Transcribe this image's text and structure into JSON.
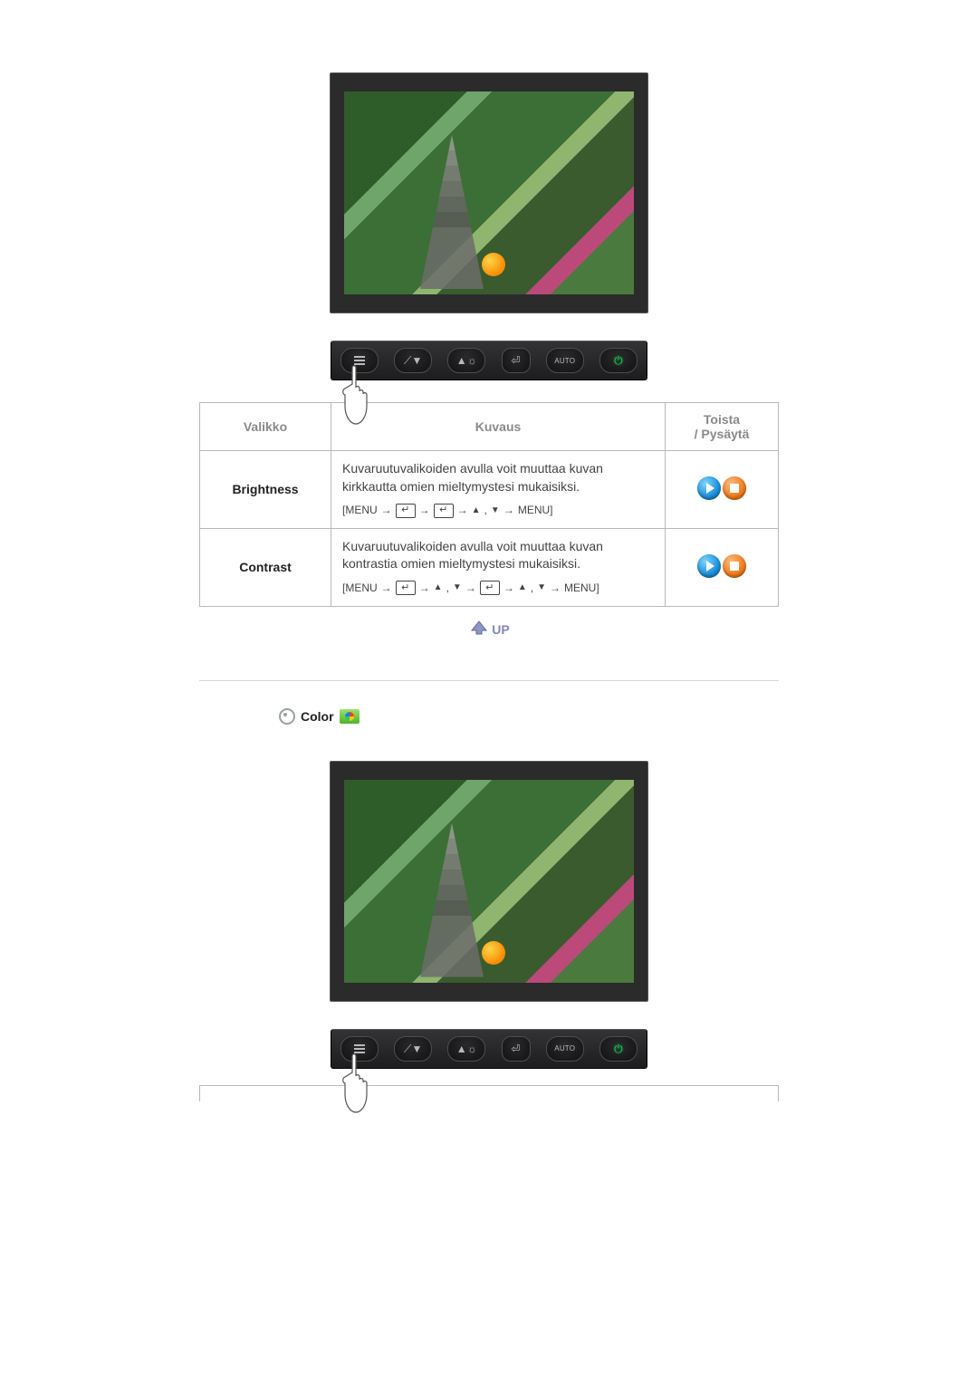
{
  "table": {
    "headers": {
      "menu": "Valikko",
      "desc": "Kuvaus",
      "play": "Toista\n/ Pysäytä"
    },
    "rows": [
      {
        "name": "Brightness",
        "desc": "Kuvaruutuvalikoiden avulla voit muuttaa kuvan kirkkautta omien mieltymystesi mukaisiksi.",
        "seq_prefix": "[MENU",
        "seq_suffix": "MENU]",
        "seq_pattern": "enter_enter"
      },
      {
        "name": "Contrast",
        "desc": "Kuvaruutuvalikoiden avulla voit muuttaa kuvan kontrastia omien mieltymystesi mukaisiksi.",
        "seq_prefix": "[MENU",
        "seq_suffix": "MENU]",
        "seq_pattern": "enter_updown_enter"
      }
    ]
  },
  "up_label": "UP",
  "section2": {
    "title": "Color"
  },
  "osd_buttons": {
    "menu": "MENU",
    "auto": "AUTO"
  }
}
